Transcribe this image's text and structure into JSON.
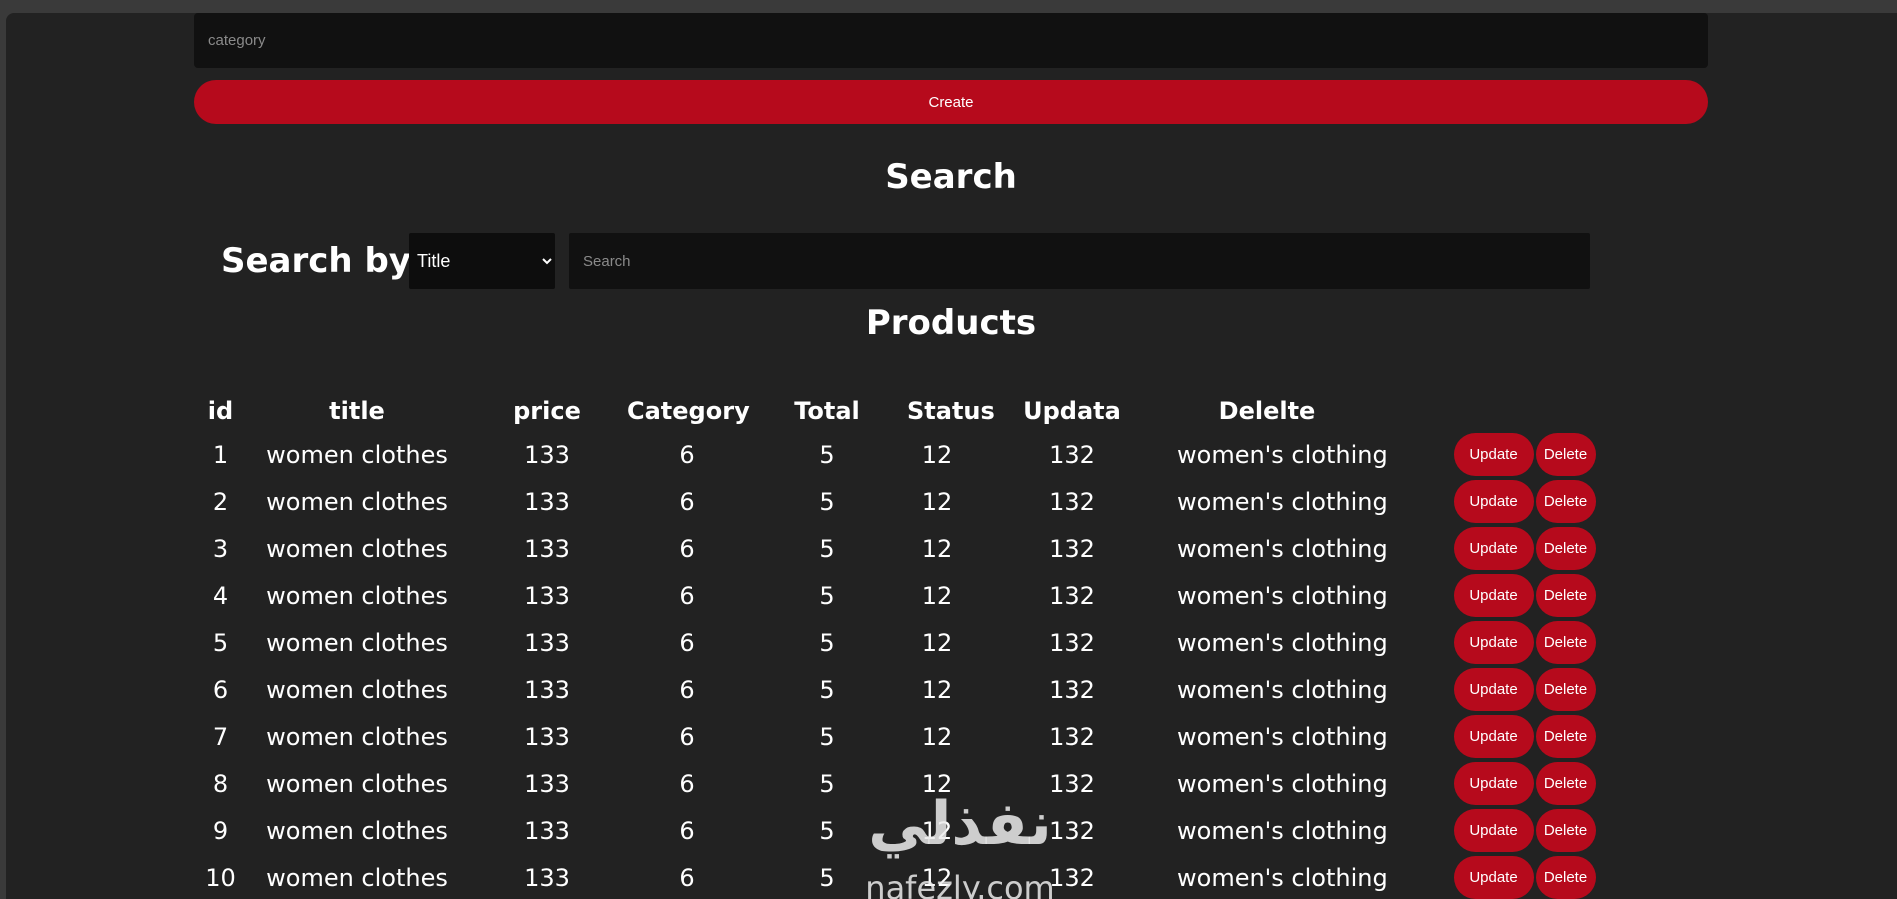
{
  "form": {
    "category_placeholder": "category",
    "create_label": "Create"
  },
  "search": {
    "title": "Search",
    "by_label": "Search by:",
    "selected_option": "Title",
    "placeholder": "Search"
  },
  "products": {
    "title": "Products",
    "columns": [
      "id",
      "title",
      "price",
      "Category",
      "Total",
      "Status",
      "Updata",
      "Delelte"
    ],
    "update_label": "Update",
    "delete_label": "Delete",
    "rows": [
      [
        "1",
        "women clothes",
        "133",
        "6",
        "5",
        "12",
        "132",
        "women's clothing"
      ],
      [
        "2",
        "women clothes",
        "133",
        "6",
        "5",
        "12",
        "132",
        "women's clothing"
      ],
      [
        "3",
        "women clothes",
        "133",
        "6",
        "5",
        "12",
        "132",
        "women's clothing"
      ],
      [
        "4",
        "women clothes",
        "133",
        "6",
        "5",
        "12",
        "132",
        "women's clothing"
      ],
      [
        "5",
        "women clothes",
        "133",
        "6",
        "5",
        "12",
        "132",
        "women's clothing"
      ],
      [
        "6",
        "women clothes",
        "133",
        "6",
        "5",
        "12",
        "132",
        "women's clothing"
      ],
      [
        "7",
        "women clothes",
        "133",
        "6",
        "5",
        "12",
        "132",
        "women's clothing"
      ],
      [
        "8",
        "women clothes",
        "133",
        "6",
        "5",
        "12",
        "132",
        "women's clothing"
      ],
      [
        "9",
        "women clothes",
        "133",
        "6",
        "5",
        "12",
        "132",
        "women's clothing"
      ],
      [
        "10",
        "women clothes",
        "133",
        "6",
        "5",
        "12",
        "132",
        "women's clothing"
      ]
    ]
  },
  "watermark": {
    "arabic": "نفذلي",
    "latin": "nafezly.com"
  },
  "colors": {
    "accent": "#b60a1c",
    "background": "#222222",
    "input_bg": "#111111"
  }
}
